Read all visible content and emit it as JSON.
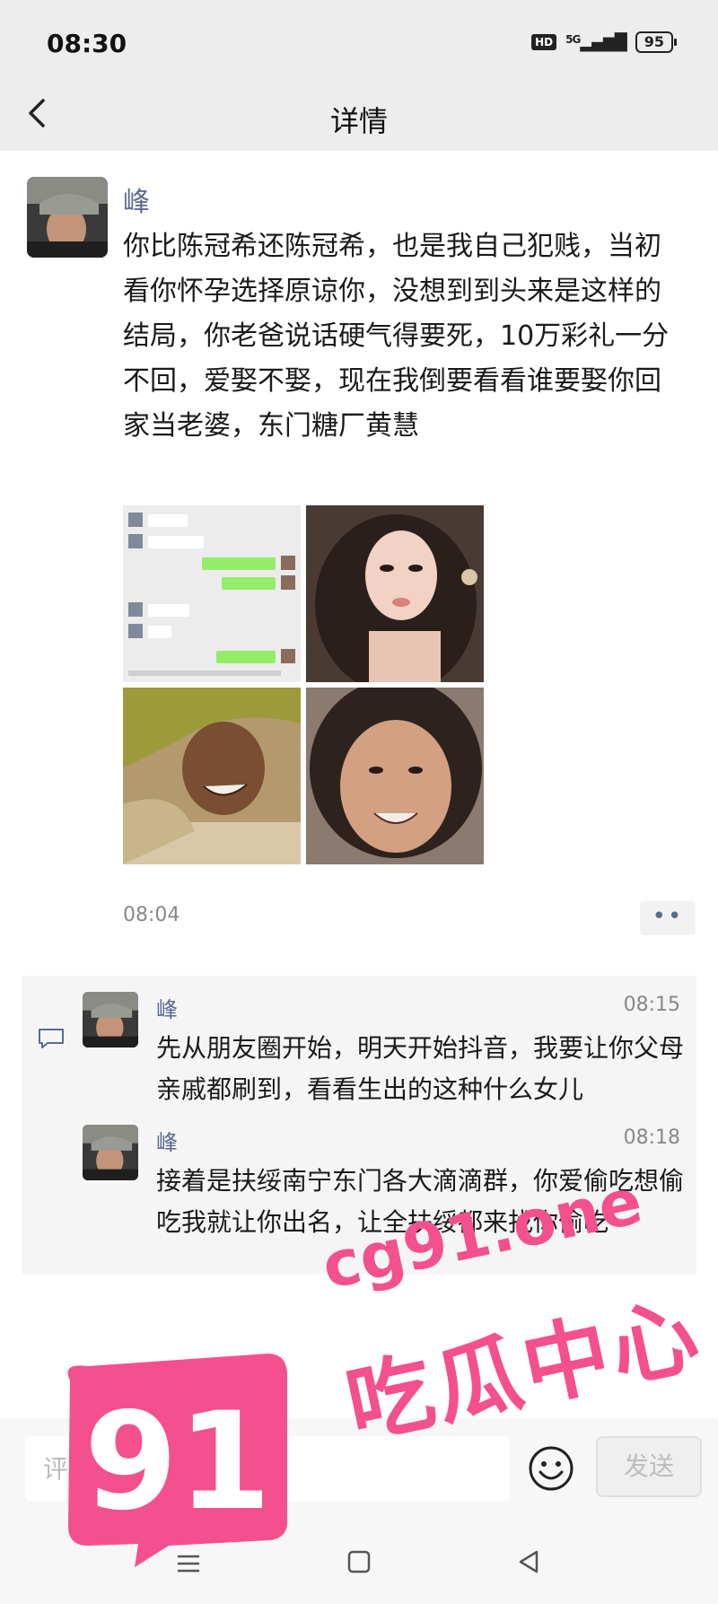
{
  "status_bar": {
    "time": "08:30",
    "network": "5G",
    "battery": "95",
    "hd": "HD"
  },
  "nav": {
    "back_icon": "chevron-left-icon",
    "title": "详情"
  },
  "post": {
    "author": "峰",
    "text": "你比陈冠希还陈冠希，也是我自己犯贱，当初看你怀孕选择原谅你，没想到到头来是这样的结局，你老爸说话硬气得要死，10万彩礼一分不回，爱娶不娶，现在我倒要看看谁要娶你回家当老婆，东门糖厂黄慧",
    "photos": [
      "chat-screenshot",
      "woman-selfie",
      "man-smiling",
      "woman-smiling"
    ],
    "time": "08:04",
    "more_label": "••"
  },
  "comments": [
    {
      "name": "峰",
      "time": "08:15",
      "text": "先从朋友圈开始，明天开始抖音，我要让你父母亲戚都刷到，看看生出的这种什么女儿"
    },
    {
      "name": "峰",
      "time": "08:18",
      "text": "接着是扶绥南宁东门各大滴滴群，你爱偷吃想偷吃我就让你出名，让全扶绥都来找你偷吃"
    }
  ],
  "input": {
    "placeholder": "评论",
    "send_label": "发送"
  },
  "watermark": {
    "number": "91",
    "url": "cg91.one",
    "name": "吃瓜中心"
  },
  "colors": {
    "accent_name": "#5b6a91",
    "watermark": "#f4508e"
  }
}
